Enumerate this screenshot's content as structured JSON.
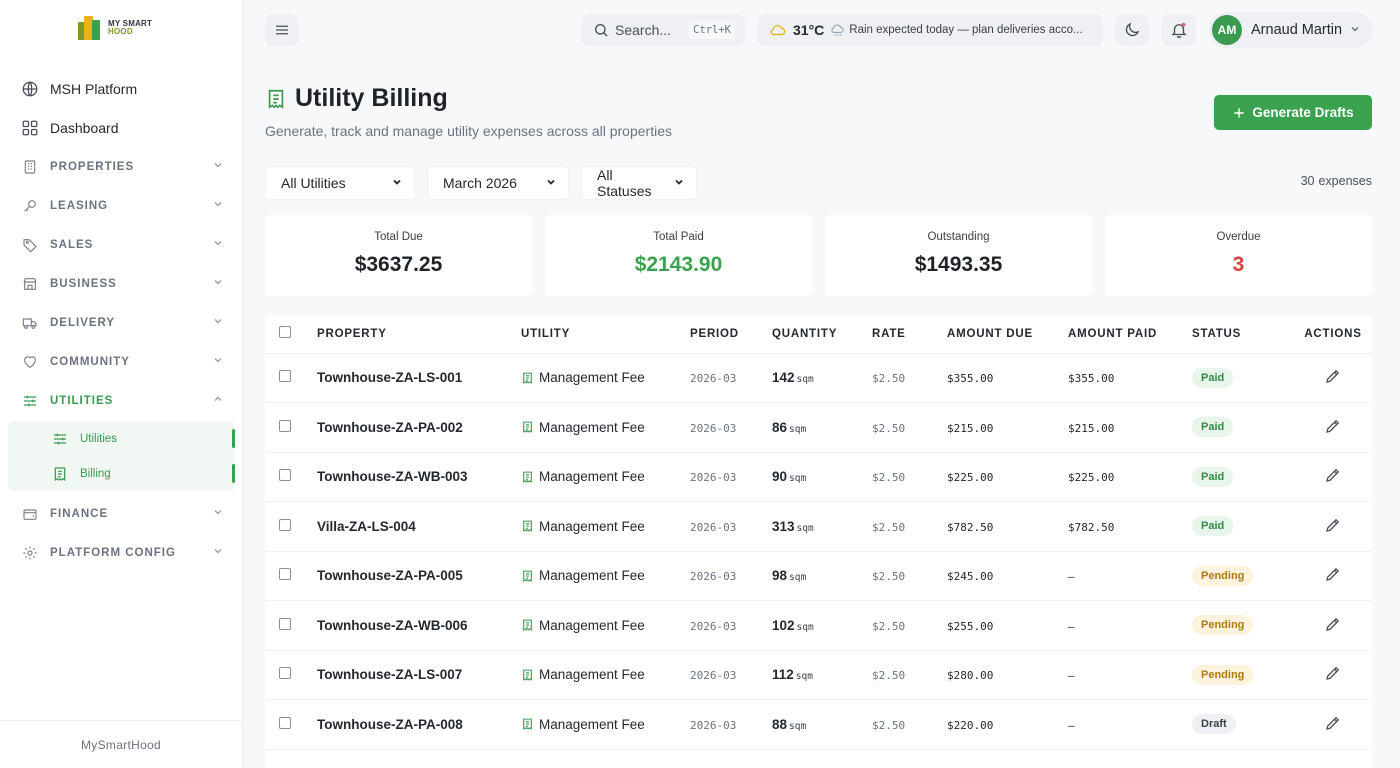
{
  "app": {
    "logo_line1": "MY SMART",
    "logo_line2": "HOOD",
    "footer": "MySmartHood"
  },
  "sidebar": {
    "items": [
      {
        "label": "MSH Platform",
        "icon": "globe-icon"
      },
      {
        "label": "Dashboard",
        "icon": "grid-icon"
      },
      {
        "label": "PROPERTIES",
        "icon": "building-icon"
      },
      {
        "label": "LEASING",
        "icon": "key-icon"
      },
      {
        "label": "SALES",
        "icon": "tag-icon"
      },
      {
        "label": "BUSINESS",
        "icon": "store-icon"
      },
      {
        "label": "DELIVERY",
        "icon": "truck-icon"
      },
      {
        "label": "COMMUNITY",
        "icon": "heart-icon"
      },
      {
        "label": "UTILITIES",
        "icon": "sliders-icon"
      },
      {
        "label": "FINANCE",
        "icon": "wallet-icon"
      },
      {
        "label": "PLATFORM CONFIG",
        "icon": "gear-icon"
      }
    ],
    "utilities_sub": [
      {
        "label": "Utilities",
        "icon": "sliders-icon"
      },
      {
        "label": "Billing",
        "icon": "receipt-icon"
      }
    ]
  },
  "header": {
    "search_placeholder": "Search...",
    "search_shortcut": "Ctrl+K",
    "weather_temp": "31°C",
    "weather_msg": "Rain expected today — plan deliveries acco...",
    "user_initials": "AM",
    "user_name": "Arnaud Martin"
  },
  "page": {
    "title": "Utility Billing",
    "subtitle": "Generate, track and manage utility expenses across all properties",
    "generate_button": "Generate Drafts",
    "filters": {
      "utility": "All Utilities",
      "period": "March 2026",
      "status": "All Statuses"
    },
    "count_value": "30",
    "count_label": "expenses"
  },
  "stats": [
    {
      "label": "Total Due",
      "value": "$3637.25"
    },
    {
      "label": "Total Paid",
      "value": "$2143.90"
    },
    {
      "label": "Outstanding",
      "value": "$1493.35"
    },
    {
      "label": "Overdue",
      "value": "3"
    }
  ],
  "table": {
    "headers": [
      "PROPERTY",
      "UTILITY",
      "PERIOD",
      "QUANTITY",
      "RATE",
      "AMOUNT DUE",
      "AMOUNT PAID",
      "STATUS",
      "ACTIONS"
    ],
    "rows": [
      {
        "property": "Townhouse-ZA-LS-001",
        "utility": "Management Fee",
        "period": "2026-03",
        "qty": "142",
        "unit": "sqm",
        "rate": "$2.50",
        "due": "$355.00",
        "paid": "$355.00",
        "status": "Paid"
      },
      {
        "property": "Townhouse-ZA-PA-002",
        "utility": "Management Fee",
        "period": "2026-03",
        "qty": "86",
        "unit": "sqm",
        "rate": "$2.50",
        "due": "$215.00",
        "paid": "$215.00",
        "status": "Paid"
      },
      {
        "property": "Townhouse-ZA-WB-003",
        "utility": "Management Fee",
        "period": "2026-03",
        "qty": "90",
        "unit": "sqm",
        "rate": "$2.50",
        "due": "$225.00",
        "paid": "$225.00",
        "status": "Paid"
      },
      {
        "property": "Villa-ZA-LS-004",
        "utility": "Management Fee",
        "period": "2026-03",
        "qty": "313",
        "unit": "sqm",
        "rate": "$2.50",
        "due": "$782.50",
        "paid": "$782.50",
        "status": "Paid"
      },
      {
        "property": "Townhouse-ZA-PA-005",
        "utility": "Management Fee",
        "period": "2026-03",
        "qty": "98",
        "unit": "sqm",
        "rate": "$2.50",
        "due": "$245.00",
        "paid": "—",
        "status": "Pending"
      },
      {
        "property": "Townhouse-ZA-WB-006",
        "utility": "Management Fee",
        "period": "2026-03",
        "qty": "102",
        "unit": "sqm",
        "rate": "$2.50",
        "due": "$255.00",
        "paid": "—",
        "status": "Pending"
      },
      {
        "property": "Townhouse-ZA-LS-007",
        "utility": "Management Fee",
        "period": "2026-03",
        "qty": "112",
        "unit": "sqm",
        "rate": "$2.50",
        "due": "$280.00",
        "paid": "—",
        "status": "Pending"
      },
      {
        "property": "Townhouse-ZA-PA-008",
        "utility": "Management Fee",
        "period": "2026-03",
        "qty": "88",
        "unit": "sqm",
        "rate": "$2.50",
        "due": "$220.00",
        "paid": "—",
        "status": "Draft"
      }
    ]
  },
  "colors": {
    "accent": "#3aa14f",
    "overdue": "#d9453d"
  }
}
